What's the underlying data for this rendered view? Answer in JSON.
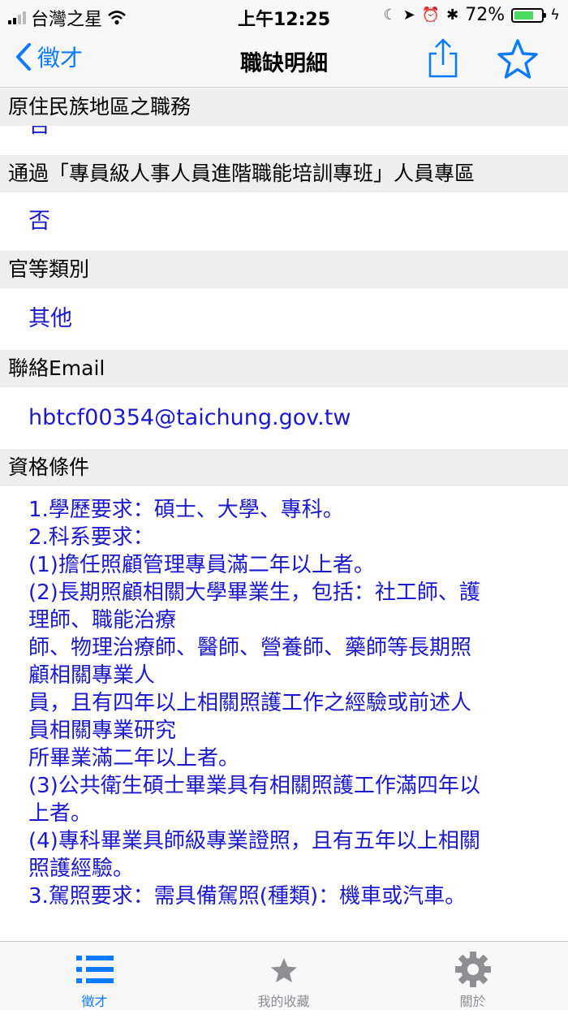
{
  "status_bar": {
    "carrier": "台灣之星",
    "time": "上午12:25",
    "battery": "72%",
    "battery_level": 0.72
  },
  "nav": {
    "back_label": "徵才",
    "title": "職缺明細"
  },
  "sections": [
    {
      "header": "原住民族地區之職務",
      "value": "否"
    },
    {
      "header": "通過「專員級人事人員進階職能培訓專班」人員專區",
      "value": "否"
    },
    {
      "header": "官等類別",
      "value": "其他"
    },
    {
      "header": "聯絡Email",
      "value": "hbtcf00354@taichung.gov.tw"
    },
    {
      "header": "資格條件"
    }
  ],
  "qualifications": [
    "1.學歷要求：碩士、大學、專科。",
    "2.科系要求：",
    "(1)擔任照顧管理專員滿二年以上者。",
    "(2)長期照顧相關大學畢業生，包括：社工師、護",
    "理師、職能治療",
    "師、物理治療師、醫師、營養師、藥師等長期照",
    "顧相關專業人",
    "員，且有四年以上相關照護工作之經驗或前述人",
    "員相關專業研究",
    "所畢業滿二年以上者。",
    "(3)公共衛生碩士畢業具有相關照護工作滿四年以",
    "上者。",
    "(4)專科畢業具師級專業證照，且有五年以上相關",
    "照護經驗。",
    "3.駕照要求：需具備駕照(種類)：機車或汽車。"
  ],
  "tabs": [
    {
      "label": "徵才",
      "icon": "list-icon",
      "active": true
    },
    {
      "label": "我的收藏",
      "icon": "star-icon",
      "active": false
    },
    {
      "label": "關於",
      "icon": "gear-icon",
      "active": false
    }
  ],
  "colors": {
    "accent": "#0a7aff",
    "value_text": "#1a1acc",
    "section_bg": "#eeeeee",
    "tab_inactive": "#8e8e93"
  }
}
